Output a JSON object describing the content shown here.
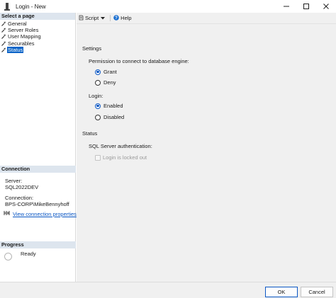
{
  "window": {
    "title": "Login - New",
    "icon": "sql-server-icon"
  },
  "left_panel": {
    "select_page_header": "Select a page",
    "pages": [
      {
        "label": "General",
        "selected": false
      },
      {
        "label": "Server Roles",
        "selected": false
      },
      {
        "label": "User Mapping",
        "selected": false
      },
      {
        "label": "Securables",
        "selected": false
      },
      {
        "label": "Status",
        "selected": true
      }
    ],
    "connection": {
      "header": "Connection",
      "server_label": "Server:",
      "server_value": "SQL2022DEV",
      "connection_label": "Connection:",
      "connection_value": "BPS-CORP\\MikeBennyhoff",
      "view_link": "View connection properties"
    },
    "progress": {
      "header": "Progress",
      "status": "Ready"
    }
  },
  "toolbar": {
    "script_label": "Script",
    "help_label": "Help"
  },
  "settings": {
    "heading": "Settings",
    "permission_label": "Permission to connect to database engine:",
    "permission_options": [
      {
        "label": "Grant",
        "checked": true
      },
      {
        "label": "Deny",
        "checked": false
      }
    ],
    "login_label": "Login:",
    "login_options": [
      {
        "label": "Enabled",
        "checked": true
      },
      {
        "label": "Disabled",
        "checked": false
      }
    ]
  },
  "status": {
    "heading": "Status",
    "auth_label": "SQL Server authentication:",
    "locked_out_label": "Login is locked out",
    "locked_out_checked": false,
    "locked_out_enabled": false
  },
  "footer": {
    "ok_label": "OK",
    "cancel_label": "Cancel"
  },
  "colors": {
    "selection": "#0a64c8",
    "section_header": "#dde5ee",
    "link": "#0b57c4",
    "content_bg": "#f0f0f0"
  }
}
